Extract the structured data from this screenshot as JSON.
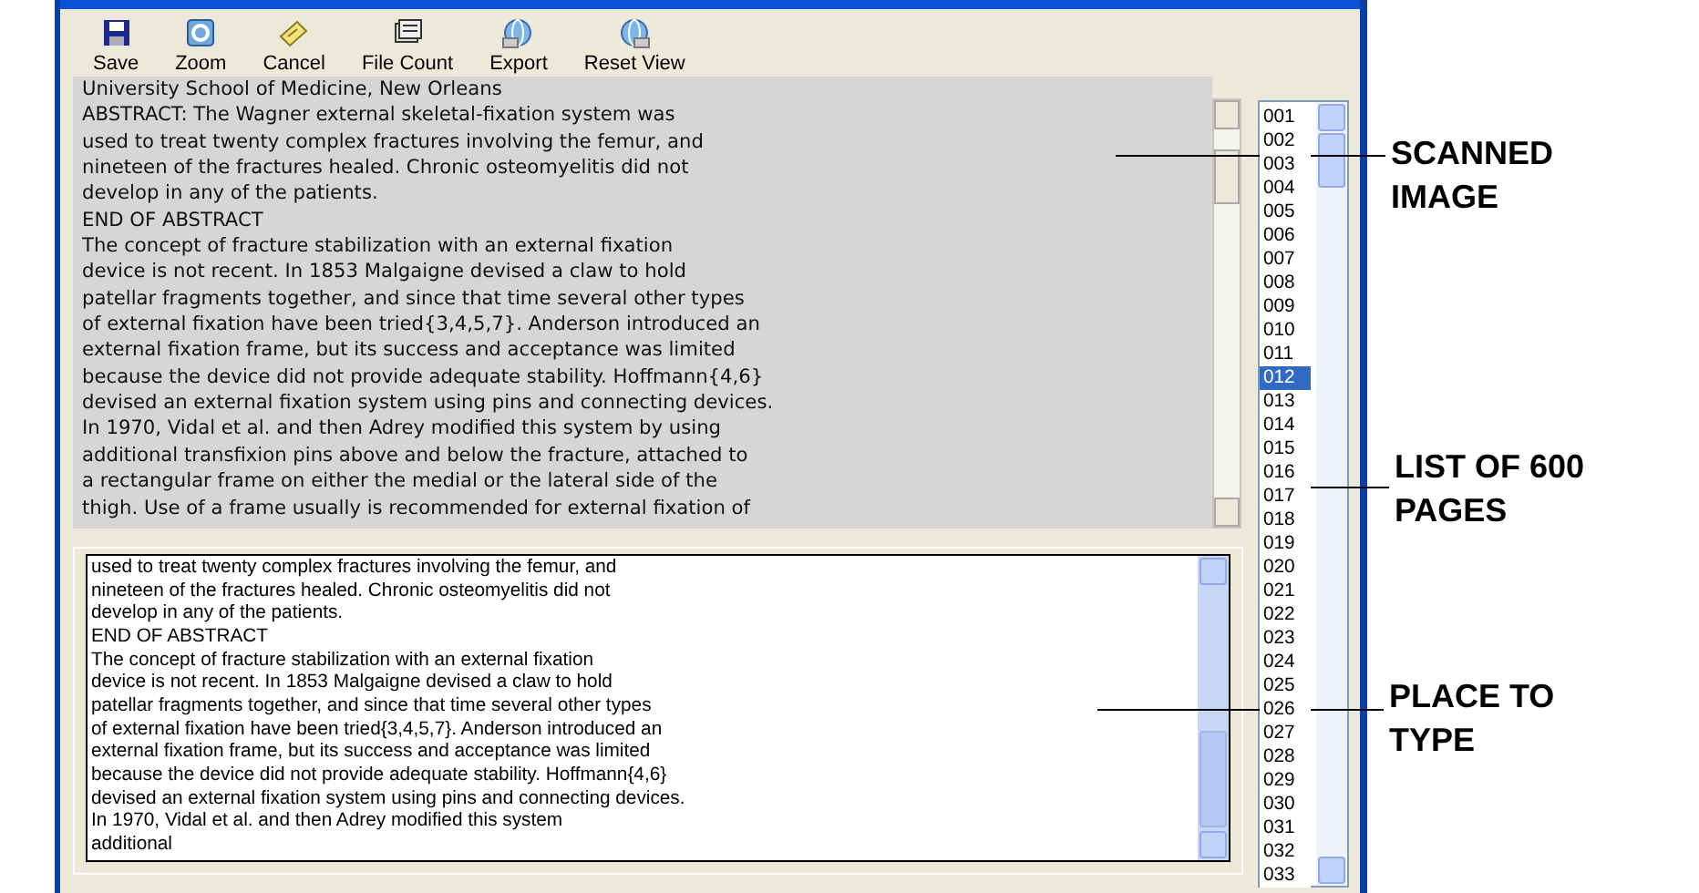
{
  "toolbar": [
    {
      "label": "Save"
    },
    {
      "label": "Zoom"
    },
    {
      "label": "Cancel"
    },
    {
      "label": "File Count"
    },
    {
      "label": "Export"
    },
    {
      "label": "Reset View"
    }
  ],
  "scanned_image": {
    "lines": [
      "University School of Medicine, New Orleans",
      "ABSTRACT: The Wagner external skeletal-fixation system was",
      "used to treat twenty complex fractures involving the femur, and",
      "nineteen of the fractures healed. Chronic osteomyelitis did not",
      "develop in any of the patients.",
      "END OF ABSTRACT",
      "The concept of fracture stabilization with an external fixation",
      "device is not recent. In 1853 Malgaigne devised a claw to hold",
      "patellar fragments together, and since that time several other types",
      "of external fixation have been tried{3,4,5,7}. Anderson introduced an",
      "external fixation frame, but its success and acceptance was limited",
      "because the device did not provide adequate stability. Hoffmann{4,6}",
      "devised an external fixation system using pins and connecting devices.",
      "In 1970, Vidal et al. and then Adrey modified this system by using",
      "additional transfixion pins above and below the fracture, attached to",
      "a rectangular frame on either the medial or the lateral side of the",
      "thigh. Use of a frame usually is recommended for external fixation of"
    ]
  },
  "typing_area": {
    "value": "used to treat twenty complex fractures involving the femur, and\nnineteen of the fractures healed. Chronic osteomyelitis did not\ndevelop in any of the patients.\nEND OF ABSTRACT\nThe concept of fracture stabilization with an external fixation\ndevice is not recent. In 1853 Malgaigne devised a claw to hold\npatellar fragments together, and since that time several other types\nof external fixation have been tried{3,4,5,7}. Anderson introduced an\nexternal fixation frame, but its success and acceptance was limited\nbecause the device did not provide adequate stability. Hoffmann{4,6}\ndevised an external fixation system using pins and connecting devices.\nIn 1970, Vidal et al. and then Adrey modified this system\nadditional "
  },
  "page_list": {
    "items": [
      {
        "label": "001",
        "selected": false
      },
      {
        "label": "002",
        "selected": false
      },
      {
        "label": "003",
        "selected": false
      },
      {
        "label": "004",
        "selected": false
      },
      {
        "label": "005",
        "selected": false
      },
      {
        "label": "006",
        "selected": false
      },
      {
        "label": "007",
        "selected": false
      },
      {
        "label": "008",
        "selected": false
      },
      {
        "label": "009",
        "selected": false
      },
      {
        "label": "010",
        "selected": false
      },
      {
        "label": "011",
        "selected": false
      },
      {
        "label": "012",
        "selected": true
      },
      {
        "label": "013",
        "selected": false
      },
      {
        "label": "014",
        "selected": false
      },
      {
        "label": "015",
        "selected": false
      },
      {
        "label": "016",
        "selected": false
      },
      {
        "label": "017",
        "selected": false
      },
      {
        "label": "018",
        "selected": false
      },
      {
        "label": "019",
        "selected": false
      },
      {
        "label": "020",
        "selected": false
      },
      {
        "label": "021",
        "selected": false
      },
      {
        "label": "022",
        "selected": false
      },
      {
        "label": "023",
        "selected": false
      },
      {
        "label": "024",
        "selected": false
      },
      {
        "label": "025",
        "selected": false
      },
      {
        "label": "026",
        "selected": false
      },
      {
        "label": "027",
        "selected": false
      },
      {
        "label": "028",
        "selected": false
      },
      {
        "label": "029",
        "selected": false
      },
      {
        "label": "030",
        "selected": false
      },
      {
        "label": "031",
        "selected": false
      },
      {
        "label": "032",
        "selected": false
      },
      {
        "label": "033",
        "selected": false
      }
    ]
  },
  "annotations": [
    {
      "label": "SCANNED IMAGE"
    },
    {
      "label": "LIST OF 600 PAGES"
    },
    {
      "label": "PLACE TO TYPE"
    }
  ]
}
